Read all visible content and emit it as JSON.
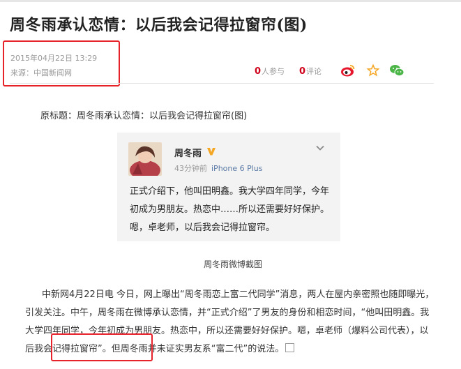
{
  "article": {
    "title": "周冬雨承认恋情：以后我会记得拉窗帘(图)",
    "date": "2015年04月22日 13:29",
    "source": "来源：中国新闻网",
    "participants_count": "0",
    "participants_label": "人参与",
    "comments_count": "0",
    "comments_label": "评论",
    "original_title": "原标题：周冬雨承认恋情：以后我会记得拉窗帘(图)",
    "caption": "周冬雨微博截图",
    "body_p1": "中新网4月22日电 今日，网上曝出“周冬雨恋上富二代同学”消息，两人在屋内亲密照也随即曝光，引发关注。中午，周冬雨在微博承认恋情，并“正式介绍”了男友的身份和相恋时间，“他叫田明鑫。我大学四年同学，今年初成为男朋友。热恋中，所以还需要好好保护。嗯，卓老师（爆料公司代表），以后我会记得拉窗帘”。但周冬雨并未证实男友系“富二代”的说法。"
  },
  "share": {
    "icons": [
      "weibo-icon",
      "star-icon",
      "wechat-icon"
    ],
    "colors": {
      "weibo": "#e6162d",
      "star": "#f5a623",
      "wechat": "#4bb548"
    }
  },
  "weibo": {
    "name": "周冬雨",
    "time": "43分钟前",
    "device": "iPhone 6 Plus",
    "text": "正式介绍下，他叫田明鑫。我大学四年同学，今年初成为男朋友。热恋中……所以还需要好好保护。嗯，卓老师，以后我会记得拉窗帘。"
  },
  "highlight_color": "#e8222a"
}
